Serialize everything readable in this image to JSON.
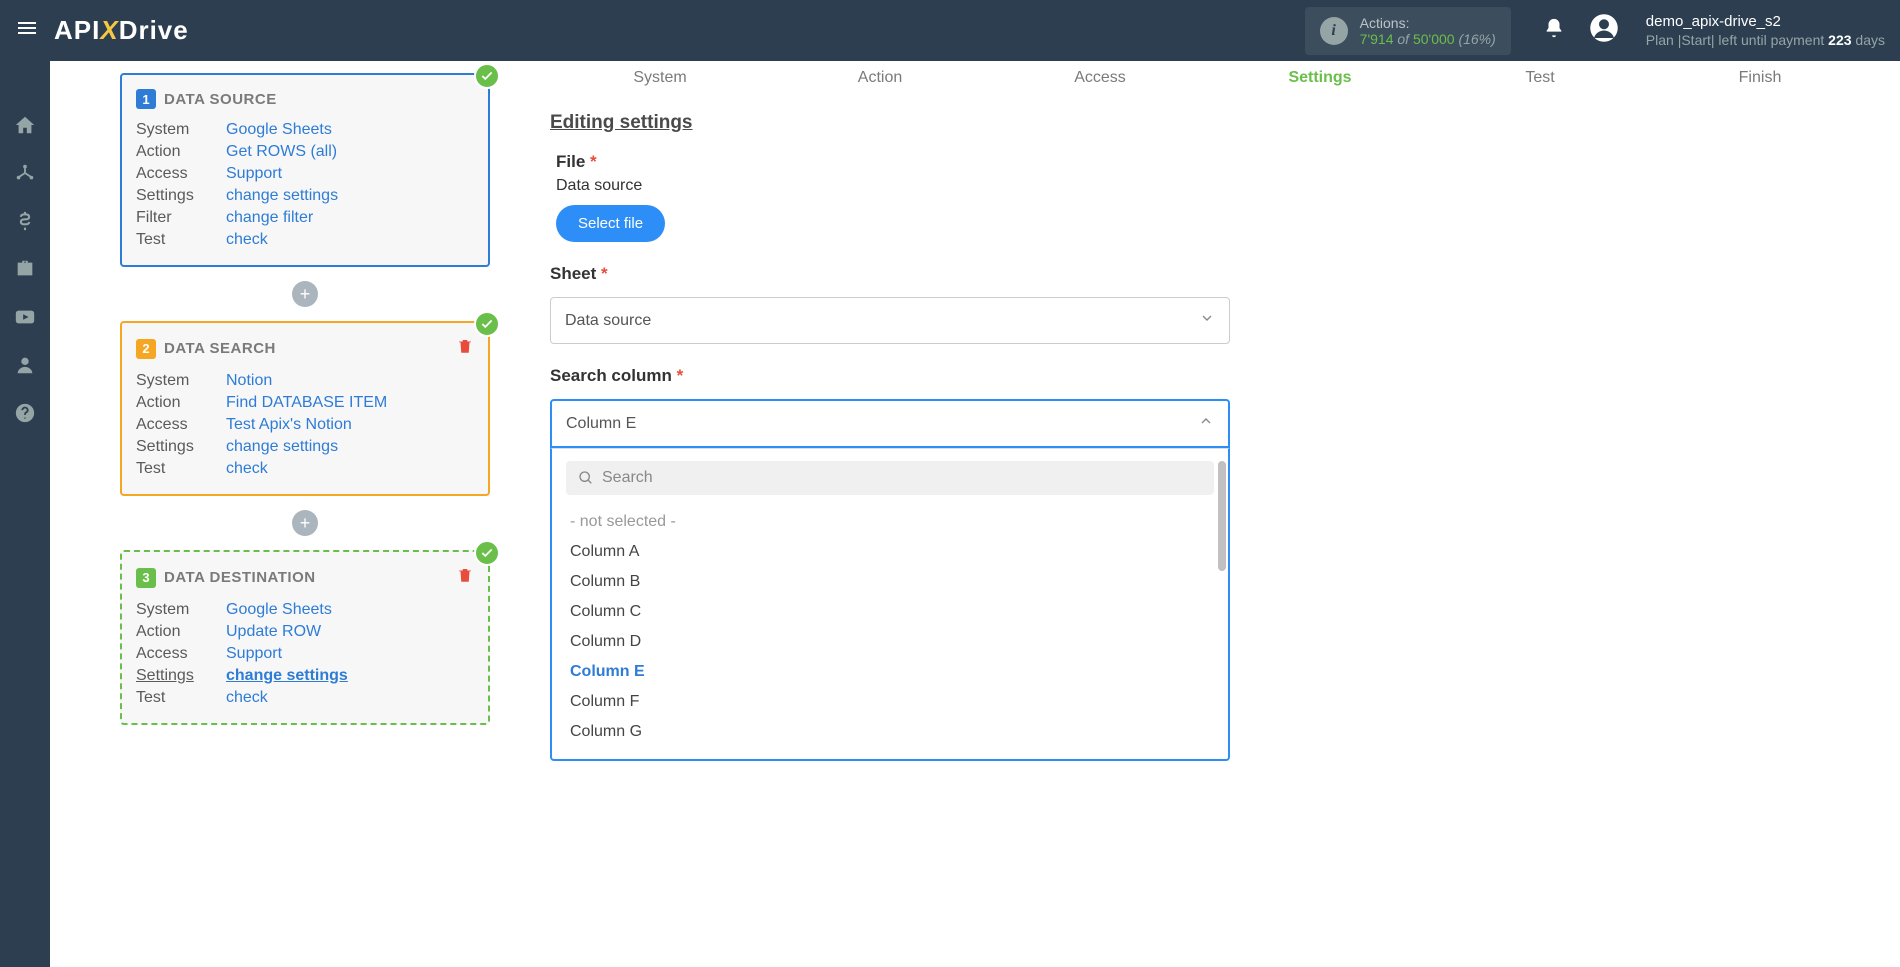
{
  "header": {
    "logo": {
      "p1": "API",
      "x": "X",
      "p2": "Drive"
    },
    "actions": {
      "label": "Actions:",
      "used": "7'914",
      "of": " of ",
      "total": "50'000",
      "pct": " (16%)"
    },
    "user": {
      "name": "demo_apix-drive_s2",
      "plan_prefix": "Plan |Start| left until payment ",
      "days": "223",
      "days_suffix": " days"
    }
  },
  "cards": [
    {
      "num": "1",
      "title": "DATA SOURCE",
      "rows": [
        {
          "label": "System",
          "value": "Google Sheets"
        },
        {
          "label": "Action",
          "value": "Get ROWS (all)"
        },
        {
          "label": "Access",
          "value": "Support"
        },
        {
          "label": "Settings",
          "value": "change settings"
        },
        {
          "label": "Filter",
          "value": "change filter"
        },
        {
          "label": "Test",
          "value": "check"
        }
      ]
    },
    {
      "num": "2",
      "title": "DATA SEARCH",
      "rows": [
        {
          "label": "System",
          "value": "Notion"
        },
        {
          "label": "Action",
          "value": "Find DATABASE ITEM"
        },
        {
          "label": "Access",
          "value": "Test Apix's Notion"
        },
        {
          "label": "Settings",
          "value": "change settings"
        },
        {
          "label": "Test",
          "value": "check"
        }
      ]
    },
    {
      "num": "3",
      "title": "DATA DESTINATION",
      "rows": [
        {
          "label": "System",
          "value": "Google Sheets"
        },
        {
          "label": "Action",
          "value": "Update ROW"
        },
        {
          "label": "Access",
          "value": "Support"
        },
        {
          "label": "Settings",
          "value": "change settings"
        },
        {
          "label": "Test",
          "value": "check"
        }
      ]
    }
  ],
  "steps": [
    "System",
    "Action",
    "Access",
    "Settings",
    "Test",
    "Finish"
  ],
  "editing": {
    "title": "Editing settings",
    "file_label": "File",
    "file_sub": "Data source",
    "select_file_btn": "Select file",
    "sheet_label": "Sheet",
    "sheet_value": "Data source",
    "search_col_label": "Search column",
    "search_col_value": "Column E",
    "search_placeholder": "Search",
    "options": [
      "- not selected -",
      "Column A",
      "Column B",
      "Column C",
      "Column D",
      "Column E",
      "Column F",
      "Column G"
    ]
  }
}
